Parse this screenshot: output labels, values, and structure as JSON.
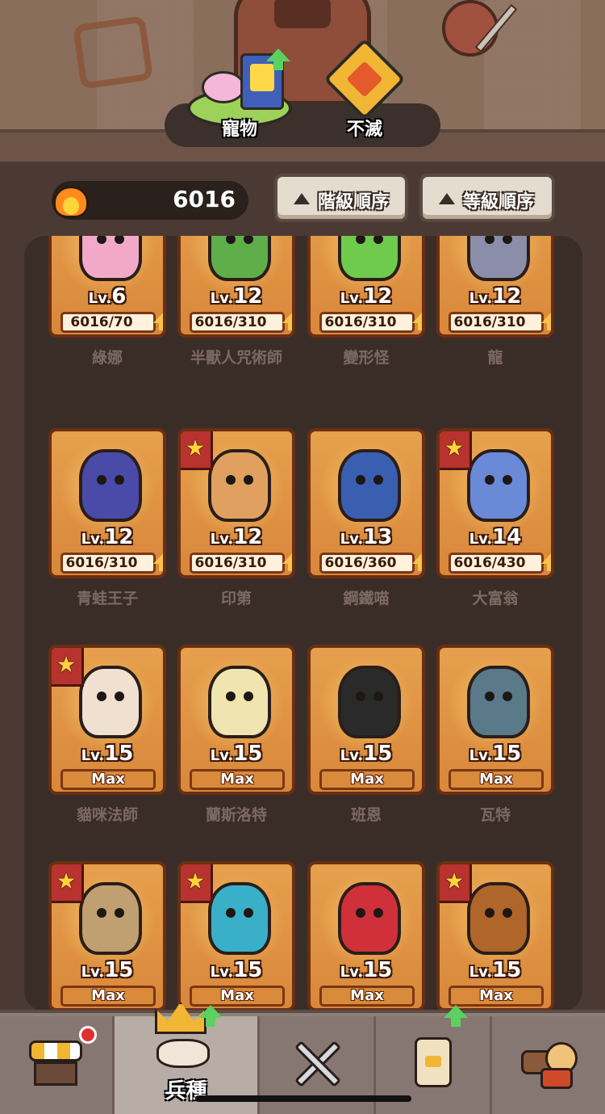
{
  "tabs": [
    {
      "label": "寵物"
    },
    {
      "label": "不滅"
    }
  ],
  "resource": {
    "value": "6016",
    "icon": "fire-icon"
  },
  "sort_buttons": [
    {
      "label": "階級順序"
    },
    {
      "label": "等級順序"
    }
  ],
  "level_prefix": "Lv.",
  "units": [
    {
      "name": "綠娜",
      "level": "6",
      "progress": "6016/70",
      "max": false,
      "star": false,
      "color": "#f2a9c8"
    },
    {
      "name": "半獸人咒術師",
      "level": "12",
      "progress": "6016/310",
      "max": false,
      "star": false,
      "color": "#5fae4a"
    },
    {
      "name": "變形怪",
      "level": "12",
      "progress": "6016/310",
      "max": false,
      "star": false,
      "color": "#6ecb4e"
    },
    {
      "name": "龍",
      "level": "12",
      "progress": "6016/310",
      "max": false,
      "star": false,
      "color": "#8a8ea8"
    },
    {
      "name": "青蛙王子",
      "level": "12",
      "progress": "6016/310",
      "max": false,
      "star": false,
      "color": "#4a4aa8"
    },
    {
      "name": "印第",
      "level": "12",
      "progress": "6016/310",
      "max": false,
      "star": true,
      "color": "#e0a060"
    },
    {
      "name": "鋼鐵喵",
      "level": "13",
      "progress": "6016/360",
      "max": false,
      "star": false,
      "color": "#3b5fb0"
    },
    {
      "name": "大富翁",
      "level": "14",
      "progress": "6016/430",
      "max": false,
      "star": true,
      "color": "#6a8ad8"
    },
    {
      "name": "貓咪法師",
      "level": "15",
      "progress": "Max",
      "max": true,
      "star": true,
      "color": "#f0e0d0"
    },
    {
      "name": "蘭斯洛特",
      "level": "15",
      "progress": "Max",
      "max": true,
      "star": false,
      "color": "#f0e4b0"
    },
    {
      "name": "班恩",
      "level": "15",
      "progress": "Max",
      "max": true,
      "star": false,
      "color": "#2a2a2a"
    },
    {
      "name": "瓦特",
      "level": "15",
      "progress": "Max",
      "max": true,
      "star": false,
      "color": "#5a7a8a"
    },
    {
      "name": "",
      "level": "15",
      "progress": "Max",
      "max": true,
      "star": true,
      "color": "#c0a070"
    },
    {
      "name": "",
      "level": "15",
      "progress": "Max",
      "max": true,
      "star": true,
      "color": "#3ab0c8"
    },
    {
      "name": "",
      "level": "15",
      "progress": "Max",
      "max": true,
      "star": false,
      "color": "#d0303a"
    },
    {
      "name": "",
      "level": "15",
      "progress": "Max",
      "max": true,
      "star": true,
      "color": "#b0652a"
    }
  ],
  "bottom_nav": [
    {
      "icon": "shop-icon",
      "label": "",
      "badge": true
    },
    {
      "icon": "crown-icon",
      "label": "兵種",
      "active": true
    },
    {
      "icon": "crossed-swords-icon",
      "label": ""
    },
    {
      "icon": "card-icon",
      "label": ""
    },
    {
      "icon": "inventory-icon",
      "label": ""
    }
  ]
}
